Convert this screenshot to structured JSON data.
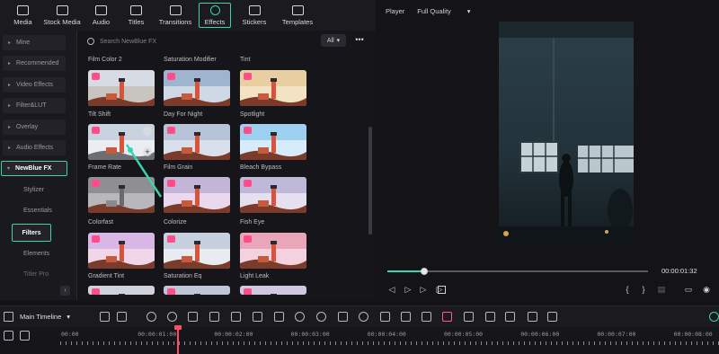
{
  "top_tabs": [
    "Media",
    "Stock Media",
    "Audio",
    "Titles",
    "Transitions",
    "Effects",
    "Stickers",
    "Templates"
  ],
  "sidebar": {
    "items": [
      "Mine",
      "Recommended",
      "Video Effects",
      "Filter&LUT",
      "Overlay",
      "Audio Effects",
      "NewBlue FX"
    ],
    "subitems": [
      "Stylizer",
      "Essentials",
      "Filters",
      "Elements",
      "Titler Pro"
    ]
  },
  "effects": {
    "search_placeholder": "Search NewBlue FX",
    "filter": "All",
    "more": "•••",
    "labels": [
      "Film Color 2",
      "Saturation Modifier",
      "Tint",
      "Tilt Shift",
      "Day For Night",
      "Spotlight",
      "Frame Rate",
      "Film Grain",
      "Bleach Bypass",
      "Colorfast",
      "Colorize",
      "Fish Eye",
      "Gradient Tint",
      "Saturation Eq",
      "Light Leak"
    ]
  },
  "player": {
    "title": "Player",
    "quality": "Full Quality",
    "timecode": "00:00:01:32",
    "progress": 0.14
  },
  "timeline": {
    "name": "Main Timeline",
    "ticks": [
      "00:00",
      "00:00:01:00",
      "00:00:02:00",
      "00:00:03:00",
      "00:00:04:00",
      "00:00:05:00",
      "00:00:06:00",
      "00:00:07:00",
      "00:00:08:00"
    ]
  },
  "colors": {
    "accent": "#35d6b1",
    "badge": "#ff4d8a",
    "playhead": "#ff4d63"
  }
}
